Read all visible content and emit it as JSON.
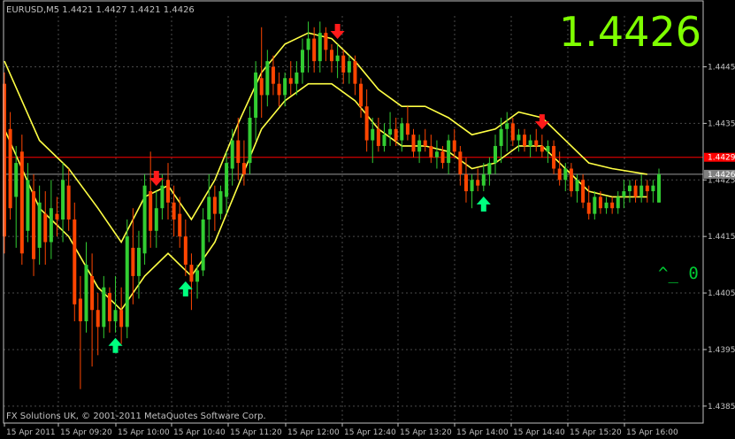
{
  "window": {
    "symbol_header": "EURUSD,M5  1.4421 1.4427 1.4421 1.4426",
    "big_price": "1.4426",
    "copyright": "FX Solutions UK, © 2001-2011 MetaQuotes Software Corp.",
    "corner_marker": "^_ 0"
  },
  "colors": {
    "background": "#000000",
    "grid": "#4a4a4a",
    "frame": "#c0c0c0",
    "axis_text": "#c0c0c0",
    "bull": "#32cd32",
    "bear": "#ff4500",
    "envelope": "#ffff44",
    "bid_line": "#ff0000",
    "bid_label_bg": "#ff0000",
    "current_label_bg": "#808080",
    "big_price": "#7fff00",
    "signal_buy": "#00ff7f",
    "signal_sell": "#ff1a1a",
    "marker": "#00cc33"
  },
  "chart_data": {
    "type": "candlestick",
    "timeframe": "M5",
    "ylim": [
      1.4382,
      1.4454
    ],
    "yticks": [
      "1.4445",
      "1.4435",
      "1.4425",
      "1.4415",
      "1.4405",
      "1.4395",
      "1.4385"
    ],
    "xticks": [
      "15 Apr 2011",
      "15 Apr 09:20",
      "15 Apr 10:00",
      "15 Apr 10:40",
      "15 Apr 11:20",
      "15 Apr 12:00",
      "15 Apr 12:40",
      "15 Apr 13:20",
      "15 Apr 14:00",
      "15 Apr 14:40",
      "15 Apr 15:20",
      "15 Apr 16:00"
    ],
    "bid_line": "1.4429",
    "current_price": "1.4426",
    "candles": [
      [
        1.4442,
        1.4444,
        1.4412,
        1.4415
      ],
      [
        1.4434,
        1.4437,
        1.4418,
        1.442
      ],
      [
        1.4422,
        1.4431,
        1.4413,
        1.4428
      ],
      [
        1.443,
        1.4433,
        1.441,
        1.4412
      ],
      [
        1.4416,
        1.4428,
        1.4414,
        1.4425
      ],
      [
        1.4423,
        1.4426,
        1.4408,
        1.4411
      ],
      [
        1.4413,
        1.4424,
        1.441,
        1.4421
      ],
      [
        1.4419,
        1.4423,
        1.441,
        1.4414
      ],
      [
        1.4414,
        1.4425,
        1.4411,
        1.442
      ],
      [
        1.4419,
        1.4422,
        1.4415,
        1.4418
      ],
      [
        1.4418,
        1.4428,
        1.4414,
        1.4425
      ],
      [
        1.4424,
        1.4427,
        1.4416,
        1.4418
      ],
      [
        1.4418,
        1.4421,
        1.44,
        1.4403
      ],
      [
        1.4404,
        1.4408,
        1.4388,
        1.44
      ],
      [
        1.44,
        1.4414,
        1.4398,
        1.441
      ],
      [
        1.4408,
        1.4412,
        1.4392,
        1.4402
      ],
      [
        1.4402,
        1.4405,
        1.4394,
        1.4399
      ],
      [
        1.4399,
        1.4408,
        1.4397,
        1.4406
      ],
      [
        1.4405,
        1.4406,
        1.4398,
        1.44
      ],
      [
        1.44,
        1.4408,
        1.4398,
        1.4402
      ],
      [
        1.4402,
        1.4406,
        1.4396,
        1.4399
      ],
      [
        1.4399,
        1.4418,
        1.4397,
        1.4415
      ],
      [
        1.4413,
        1.442,
        1.4403,
        1.4408
      ],
      [
        1.4408,
        1.4416,
        1.4404,
        1.4413
      ],
      [
        1.4412,
        1.4426,
        1.441,
        1.4424
      ],
      [
        1.4423,
        1.443,
        1.4413,
        1.4416
      ],
      [
        1.4416,
        1.4423,
        1.4413,
        1.442
      ],
      [
        1.442,
        1.4426,
        1.4418,
        1.4424
      ],
      [
        1.4425,
        1.4428,
        1.4418,
        1.4421
      ],
      [
        1.4421,
        1.4424,
        1.4415,
        1.4418
      ],
      [
        1.4419,
        1.4422,
        1.4413,
        1.4415
      ],
      [
        1.4415,
        1.4418,
        1.4408,
        1.441
      ],
      [
        1.441,
        1.4412,
        1.4402,
        1.4407
      ],
      [
        1.4407,
        1.441,
        1.4404,
        1.4409
      ],
      [
        1.4409,
        1.442,
        1.4408,
        1.4418
      ],
      [
        1.4418,
        1.4426,
        1.4414,
        1.4422
      ],
      [
        1.4422,
        1.4424,
        1.4416,
        1.4419
      ],
      [
        1.4419,
        1.4424,
        1.4418,
        1.4423
      ],
      [
        1.4422,
        1.443,
        1.4419,
        1.4428
      ],
      [
        1.4427,
        1.4434,
        1.4424,
        1.4432
      ],
      [
        1.4432,
        1.4436,
        1.4425,
        1.4428
      ],
      [
        1.4428,
        1.4432,
        1.4424,
        1.4426
      ],
      [
        1.4428,
        1.4438,
        1.4426,
        1.4436
      ],
      [
        1.4436,
        1.4446,
        1.4432,
        1.4444
      ],
      [
        1.4443,
        1.4452,
        1.4436,
        1.444
      ],
      [
        1.444,
        1.4448,
        1.4438,
        1.4446
      ],
      [
        1.4445,
        1.4447,
        1.444,
        1.4442
      ],
      [
        1.4442,
        1.4444,
        1.4438,
        1.444
      ],
      [
        1.444,
        1.4444,
        1.4438,
        1.4443
      ],
      [
        1.4443,
        1.4446,
        1.444,
        1.4442
      ],
      [
        1.4442,
        1.4446,
        1.444,
        1.4444
      ],
      [
        1.4444,
        1.445,
        1.4442,
        1.4448
      ],
      [
        1.4448,
        1.4453,
        1.4444,
        1.445
      ],
      [
        1.445,
        1.4452,
        1.4444,
        1.4446
      ],
      [
        1.4446,
        1.4453,
        1.4444,
        1.4451
      ],
      [
        1.4451,
        1.4452,
        1.4446,
        1.4448
      ],
      [
        1.4448,
        1.4449,
        1.4444,
        1.4446
      ],
      [
        1.4446,
        1.4449,
        1.4443,
        1.4447
      ],
      [
        1.4447,
        1.4448,
        1.4442,
        1.4444
      ],
      [
        1.4444,
        1.4447,
        1.4442,
        1.4446
      ],
      [
        1.4446,
        1.4447,
        1.444,
        1.4442
      ],
      [
        1.4442,
        1.4443,
        1.4436,
        1.4438
      ],
      [
        1.4438,
        1.4441,
        1.443,
        1.4432
      ],
      [
        1.4432,
        1.4436,
        1.4428,
        1.4434
      ],
      [
        1.4434,
        1.4436,
        1.443,
        1.4431
      ],
      [
        1.4431,
        1.4435,
        1.443,
        1.4433
      ],
      [
        1.4433,
        1.4437,
        1.4431,
        1.4434
      ],
      [
        1.4434,
        1.4436,
        1.4431,
        1.4432
      ],
      [
        1.4432,
        1.4436,
        1.443,
        1.4435
      ],
      [
        1.4435,
        1.4438,
        1.4432,
        1.4433
      ],
      [
        1.4433,
        1.4434,
        1.4429,
        1.443
      ],
      [
        1.443,
        1.4433,
        1.4428,
        1.4432
      ],
      [
        1.4432,
        1.4434,
        1.443,
        1.4431
      ],
      [
        1.4431,
        1.4433,
        1.4428,
        1.4429
      ],
      [
        1.4429,
        1.4432,
        1.4427,
        1.443
      ],
      [
        1.443,
        1.4431,
        1.4427,
        1.4428
      ],
      [
        1.4428,
        1.4433,
        1.4426,
        1.4432
      ],
      [
        1.4432,
        1.4434,
        1.4429,
        1.443
      ],
      [
        1.443,
        1.4431,
        1.4424,
        1.4426
      ],
      [
        1.4426,
        1.4429,
        1.4421,
        1.4423
      ],
      [
        1.4423,
        1.4426,
        1.442,
        1.4425
      ],
      [
        1.4425,
        1.4427,
        1.4423,
        1.4424
      ],
      [
        1.4424,
        1.4428,
        1.4423,
        1.4426
      ],
      [
        1.4426,
        1.4429,
        1.4424,
        1.4428
      ],
      [
        1.4428,
        1.4433,
        1.4426,
        1.4431
      ],
      [
        1.4431,
        1.4436,
        1.4428,
        1.4434
      ],
      [
        1.4434,
        1.4437,
        1.443,
        1.4435
      ],
      [
        1.4435,
        1.4436,
        1.4431,
        1.4432
      ],
      [
        1.4432,
        1.4434,
        1.443,
        1.4433
      ],
      [
        1.4433,
        1.4434,
        1.443,
        1.4431
      ],
      [
        1.4431,
        1.4433,
        1.4429,
        1.4432
      ],
      [
        1.4432,
        1.4434,
        1.443,
        1.4431
      ],
      [
        1.4431,
        1.4433,
        1.4429,
        1.443
      ],
      [
        1.443,
        1.4432,
        1.4428,
        1.4431
      ],
      [
        1.4431,
        1.4432,
        1.4426,
        1.4427
      ],
      [
        1.4427,
        1.443,
        1.4424,
        1.4425
      ],
      [
        1.4425,
        1.4428,
        1.4423,
        1.4427
      ],
      [
        1.4427,
        1.4428,
        1.4422,
        1.4423
      ],
      [
        1.4423,
        1.4426,
        1.4421,
        1.4425
      ],
      [
        1.4425,
        1.4426,
        1.442,
        1.4421
      ],
      [
        1.4421,
        1.4424,
        1.4418,
        1.4419
      ],
      [
        1.4419,
        1.4423,
        1.4418,
        1.4422
      ],
      [
        1.4422,
        1.4423,
        1.4419,
        1.442
      ],
      [
        1.442,
        1.4422,
        1.4419,
        1.4421
      ],
      [
        1.4421,
        1.4422,
        1.4419,
        1.442
      ],
      [
        1.442,
        1.4423,
        1.4419,
        1.4422
      ],
      [
        1.4422,
        1.4425,
        1.442,
        1.4423
      ],
      [
        1.4423,
        1.4425,
        1.4421,
        1.4424
      ],
      [
        1.4424,
        1.4425,
        1.4421,
        1.4422
      ],
      [
        1.4422,
        1.4426,
        1.4421,
        1.4424
      ],
      [
        1.4424,
        1.4425,
        1.4421,
        1.4423
      ],
      [
        1.4423,
        1.4425,
        1.4421,
        1.4424
      ],
      [
        1.4421,
        1.4427,
        1.4421,
        1.4426
      ]
    ],
    "envelope_upper": [
      [
        0,
        1.4446
      ],
      [
        6,
        1.4432
      ],
      [
        11,
        1.4427
      ],
      [
        16,
        1.442
      ],
      [
        20,
        1.4414
      ],
      [
        24,
        1.4422
      ],
      [
        28,
        1.4424
      ],
      [
        32,
        1.4418
      ],
      [
        36,
        1.4425
      ],
      [
        40,
        1.4435
      ],
      [
        44,
        1.4444
      ],
      [
        48,
        1.4449
      ],
      [
        52,
        1.4451
      ],
      [
        56,
        1.445
      ],
      [
        60,
        1.4446
      ],
      [
        64,
        1.4441
      ],
      [
        68,
        1.4438
      ],
      [
        72,
        1.4438
      ],
      [
        76,
        1.4436
      ],
      [
        80,
        1.4433
      ],
      [
        84,
        1.4434
      ],
      [
        88,
        1.4437
      ],
      [
        92,
        1.4436
      ],
      [
        96,
        1.4432
      ],
      [
        100,
        1.4428
      ],
      [
        104,
        1.4427
      ],
      [
        110,
        1.4426
      ]
    ],
    "envelope_lower": [
      [
        0,
        1.4434
      ],
      [
        6,
        1.442
      ],
      [
        11,
        1.4415
      ],
      [
        16,
        1.4406
      ],
      [
        20,
        1.4402
      ],
      [
        24,
        1.4408
      ],
      [
        28,
        1.4412
      ],
      [
        32,
        1.4408
      ],
      [
        36,
        1.4414
      ],
      [
        40,
        1.4424
      ],
      [
        44,
        1.4434
      ],
      [
        48,
        1.4439
      ],
      [
        52,
        1.4442
      ],
      [
        56,
        1.4442
      ],
      [
        60,
        1.4439
      ],
      [
        64,
        1.4434
      ],
      [
        68,
        1.4431
      ],
      [
        72,
        1.4431
      ],
      [
        76,
        1.443
      ],
      [
        80,
        1.4427
      ],
      [
        84,
        1.4428
      ],
      [
        88,
        1.4431
      ],
      [
        92,
        1.4431
      ],
      [
        96,
        1.4427
      ],
      [
        100,
        1.4423
      ],
      [
        104,
        1.4422
      ],
      [
        110,
        1.4422
      ]
    ],
    "signals": [
      {
        "type": "buy",
        "index": 19
      },
      {
        "type": "sell",
        "index": 26
      },
      {
        "type": "buy",
        "index": 31
      },
      {
        "type": "sell",
        "index": 57
      },
      {
        "type": "buy",
        "index": 82
      },
      {
        "type": "sell",
        "index": 92
      }
    ]
  }
}
